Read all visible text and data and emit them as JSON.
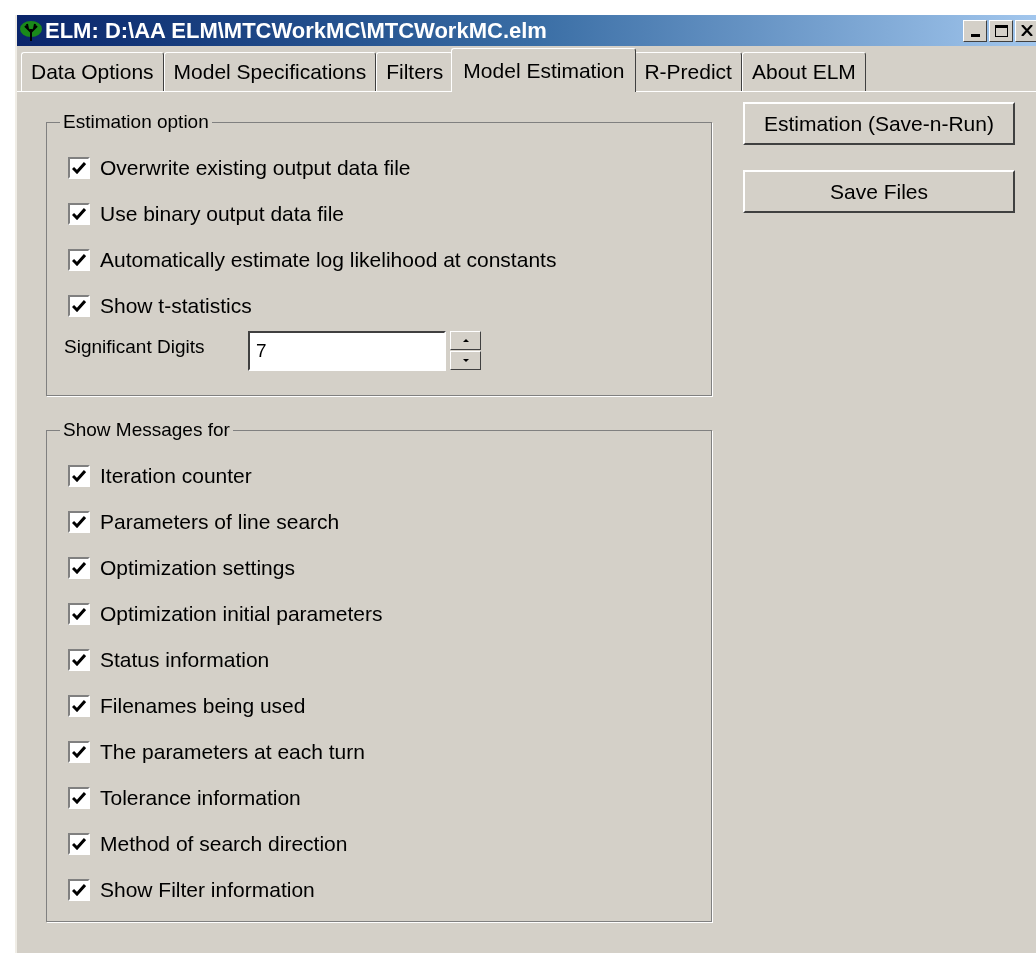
{
  "window": {
    "title": "ELM: D:\\AA ELM\\MTCWorkMC\\MTCWorkMC.elm"
  },
  "tabs": [
    {
      "label": "Data Options",
      "selected": false
    },
    {
      "label": "Model Specifications",
      "selected": false
    },
    {
      "label": "Filters",
      "selected": false
    },
    {
      "label": "Model Estimation",
      "selected": true
    },
    {
      "label": "R-Predict",
      "selected": false
    },
    {
      "label": "About ELM",
      "selected": false
    }
  ],
  "estimation_option": {
    "title": "Estimation option",
    "options": [
      {
        "label": "Overwrite existing output data file",
        "checked": true
      },
      {
        "label": "Use binary output data file",
        "checked": true
      },
      {
        "label": "Automatically estimate log likelihood at constants",
        "checked": true
      },
      {
        "label": "Show t-statistics",
        "checked": true
      }
    ],
    "significant_digits": {
      "label": "Significant Digits",
      "value": "7"
    }
  },
  "show_messages": {
    "title": "Show Messages for",
    "options": [
      {
        "label": "Iteration counter",
        "checked": true
      },
      {
        "label": "Parameters of line search",
        "checked": true
      },
      {
        "label": "Optimization settings",
        "checked": true
      },
      {
        "label": "Optimization initial parameters",
        "checked": true
      },
      {
        "label": "Status information",
        "checked": true
      },
      {
        "label": "Filenames being used",
        "checked": true
      },
      {
        "label": "The parameters at each turn",
        "checked": true
      },
      {
        "label": "Tolerance information",
        "checked": true
      },
      {
        "label": "Method of search direction",
        "checked": true
      },
      {
        "label": "Show Filter information",
        "checked": true
      }
    ]
  },
  "buttons": [
    "Estimation (Save-n-Run)",
    "Save Files"
  ]
}
